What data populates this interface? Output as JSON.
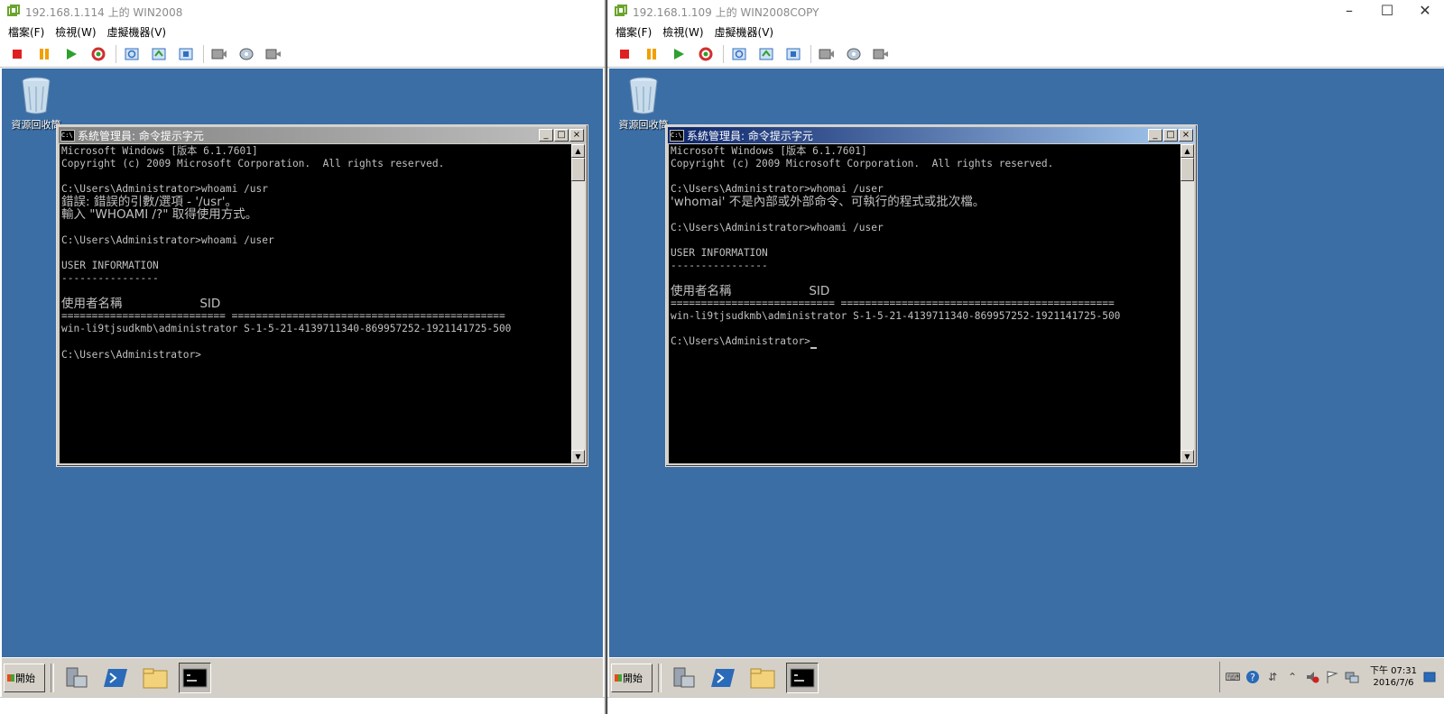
{
  "left_vm": {
    "title": "192.168.1.114 上的 WIN2008",
    "menu": [
      "檔案(F)",
      "檢視(W)",
      "虛擬機器(V)"
    ],
    "desktop": {
      "recycle_label": "資源回收筒"
    },
    "cmd": {
      "title": "系統管理員: 命令提示字元",
      "lines": [
        "Microsoft Windows [版本 6.1.7601]",
        "Copyright (c) 2009 Microsoft Corporation.  All rights reserved.",
        "",
        "C:\\Users\\Administrator>whoami /usr",
        "錯誤: 錯誤的引數/選項 - '/usr'。",
        "輸入 \"WHOAMI /?\" 取得使用方式。",
        "",
        "C:\\Users\\Administrator>whoami /user",
        "",
        "USER INFORMATION",
        "----------------",
        "",
        "使用者名稱                    SID",
        "=========================== =============================================",
        "win-li9tjsudkmb\\administrator S-1-5-21-4139711340-869957252-1921141725-500",
        "",
        "C:\\Users\\Administrator>"
      ]
    },
    "taskbar": {
      "start_label": "開始"
    }
  },
  "right_vm": {
    "title": "192.168.1.109 上的 WIN2008COPY",
    "menu": [
      "檔案(F)",
      "檢視(W)",
      "虛擬機器(V)"
    ],
    "desktop": {
      "recycle_label": "資源回收筒"
    },
    "cmd": {
      "title": "系統管理員: 命令提示字元",
      "lines": [
        "Microsoft Windows [版本 6.1.7601]",
        "Copyright (c) 2009 Microsoft Corporation.  All rights reserved.",
        "",
        "C:\\Users\\Administrator>whomai /user",
        "'whomai' 不是內部或外部命令、可執行的程式或批次檔。",
        "",
        "C:\\Users\\Administrator>whoami /user",
        "",
        "USER INFORMATION",
        "----------------",
        "",
        "使用者名稱                    SID",
        "=========================== =============================================",
        "win-li9tjsudkmb\\administrator S-1-5-21-4139711340-869957252-1921141725-500",
        "",
        "C:\\Users\\Administrator>"
      ]
    },
    "taskbar": {
      "start_label": "開始"
    },
    "clock": {
      "time": "下午 07:31",
      "date": "2016/7/6"
    }
  },
  "colors": {
    "desktop": "#3b6ea5",
    "console_bg": "#000000",
    "console_text": "#c0c0c0"
  }
}
